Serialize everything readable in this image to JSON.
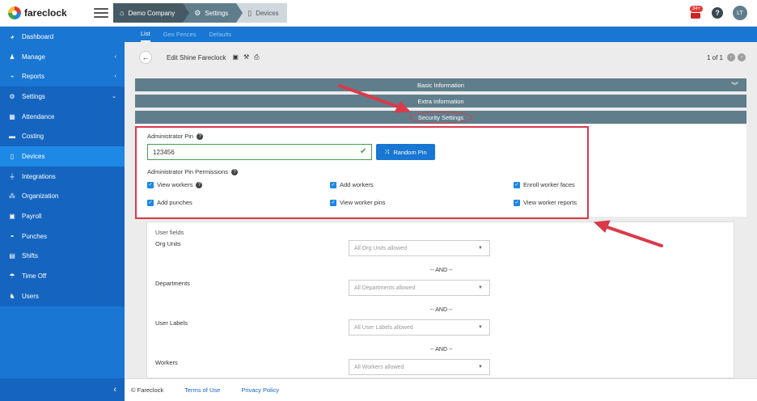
{
  "brand": {
    "name": "fareclock"
  },
  "breadcrumb": [
    {
      "label": "Demo Company",
      "icon": "home-icon"
    },
    {
      "label": "Settings",
      "icon": "gear-icon"
    },
    {
      "label": "Devices",
      "icon": "device-icon"
    }
  ],
  "header": {
    "notification_count": "34+",
    "help_label": "?",
    "avatar_initials": "LT"
  },
  "sidebar": {
    "items": [
      {
        "label": "Dashboard",
        "icon": "dashboard-icon"
      },
      {
        "label": "Manage",
        "icon": "user-icon",
        "chevron": "‹"
      },
      {
        "label": "Reports",
        "icon": "chart-icon",
        "chevron": "‹"
      },
      {
        "label": "Settings",
        "icon": "gear-icon",
        "chevron": "⌄"
      },
      {
        "label": "Attendance",
        "icon": "calendar-icon"
      },
      {
        "label": "Costing",
        "icon": "briefcase-icon"
      },
      {
        "label": "Devices",
        "icon": "device-icon"
      },
      {
        "label": "Integrations",
        "icon": "plug-icon"
      },
      {
        "label": "Organization",
        "icon": "sitemap-icon"
      },
      {
        "label": "Payroll",
        "icon": "money-icon"
      },
      {
        "label": "Punches",
        "icon": "car-icon"
      },
      {
        "label": "Shifts",
        "icon": "schedule-icon"
      },
      {
        "label": "Time Off",
        "icon": "umbrella-icon"
      },
      {
        "label": "Users",
        "icon": "users-icon"
      }
    ],
    "collapse_label": "‹"
  },
  "tabs": [
    {
      "label": "List",
      "active": true
    },
    {
      "label": "Geo Fences",
      "active": false
    },
    {
      "label": "Defaults",
      "active": false
    }
  ],
  "toolbar": {
    "title": "Edit Shine Fareclock",
    "pager_text": "1 of 1"
  },
  "sections": {
    "basic": "Basic Information",
    "extra": "Extra Information",
    "security": "Security Settings"
  },
  "security": {
    "pin_label": "Administrator Pin",
    "pin_value": "123456",
    "random_pin_label": "Random Pin",
    "permissions_label": "Administrator Pin Permissions",
    "permissions": [
      {
        "label": "View workers",
        "checked": true,
        "help": true
      },
      {
        "label": "Add workers",
        "checked": true
      },
      {
        "label": "Enroll worker faces",
        "checked": true
      },
      {
        "label": "Add punches",
        "checked": true
      },
      {
        "label": "View worker pins",
        "checked": true
      },
      {
        "label": "View worker reports",
        "checked": true
      }
    ]
  },
  "user_fields": {
    "title": "User fields",
    "rows": [
      {
        "label": "Org Units",
        "placeholder": "All Org Units allowed"
      },
      {
        "label": "Departments",
        "placeholder": "All Departments allowed"
      },
      {
        "label": "User Labels",
        "placeholder": "All User Labels allowed"
      },
      {
        "label": "Workers",
        "placeholder": "All Workers allowed"
      }
    ],
    "and_label": "-- AND --"
  },
  "footer": {
    "copyright": "© Fareclock",
    "terms": "Terms of Use",
    "privacy": "Privacy Policy"
  },
  "annotation_color": "#d93a4a",
  "accent_color": "#1976d2"
}
